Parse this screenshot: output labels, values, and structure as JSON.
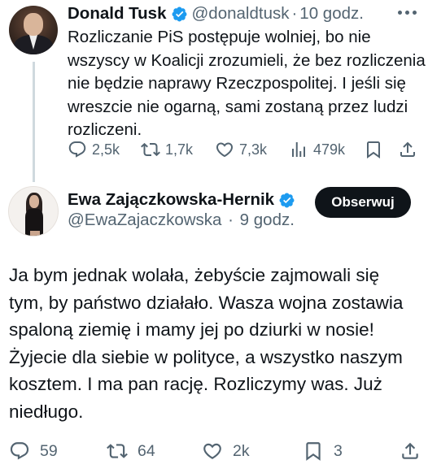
{
  "original_tweet": {
    "author_name": "Donald Tusk",
    "handle": "@donaldtusk",
    "separator": "·",
    "time": "10 godz.",
    "text": "Rozliczanie PiS postępuje wolniej, bo nie\nwszyscy w Koalicji zrozumieli, że bez rozliczenia\nnie będzie naprawy Rzeczpospolitej. I jeśli się\nwreszcie nie ogarną, sami zostaną przez ludzi\nrozliczeni.",
    "stats": {
      "replies": "2,5k",
      "reposts": "1,7k",
      "likes": "7,3k",
      "views": "479k"
    }
  },
  "reply_tweet": {
    "author_name": "Ewa Zajączkowska-Hernik",
    "handle": "@EwaZajaczkowska",
    "separator": "·",
    "time": "9 godz.",
    "follow_label": "Obserwuj",
    "text": "Ja bym jednak wolała, żebyście zajmowali się\ntym, by państwo działało. Wasza wojna zostawia\nspaloną ziemię i mamy jej po dziurki w nosie!\nŻyjecie dla siebie w polityce, a wszystko naszym\nkosztem. I ma pan rację. Rozliczymy was. Już\nniedługo.",
    "stats": {
      "replies": "59",
      "reposts": "64",
      "likes": "2k",
      "bookmarks": "3"
    }
  },
  "colors": {
    "text": "#0f1419",
    "secondary": "#536471",
    "verified": "#1d9bf0",
    "thread_line": "#cfd9de",
    "follow_bg": "#0f1419"
  }
}
